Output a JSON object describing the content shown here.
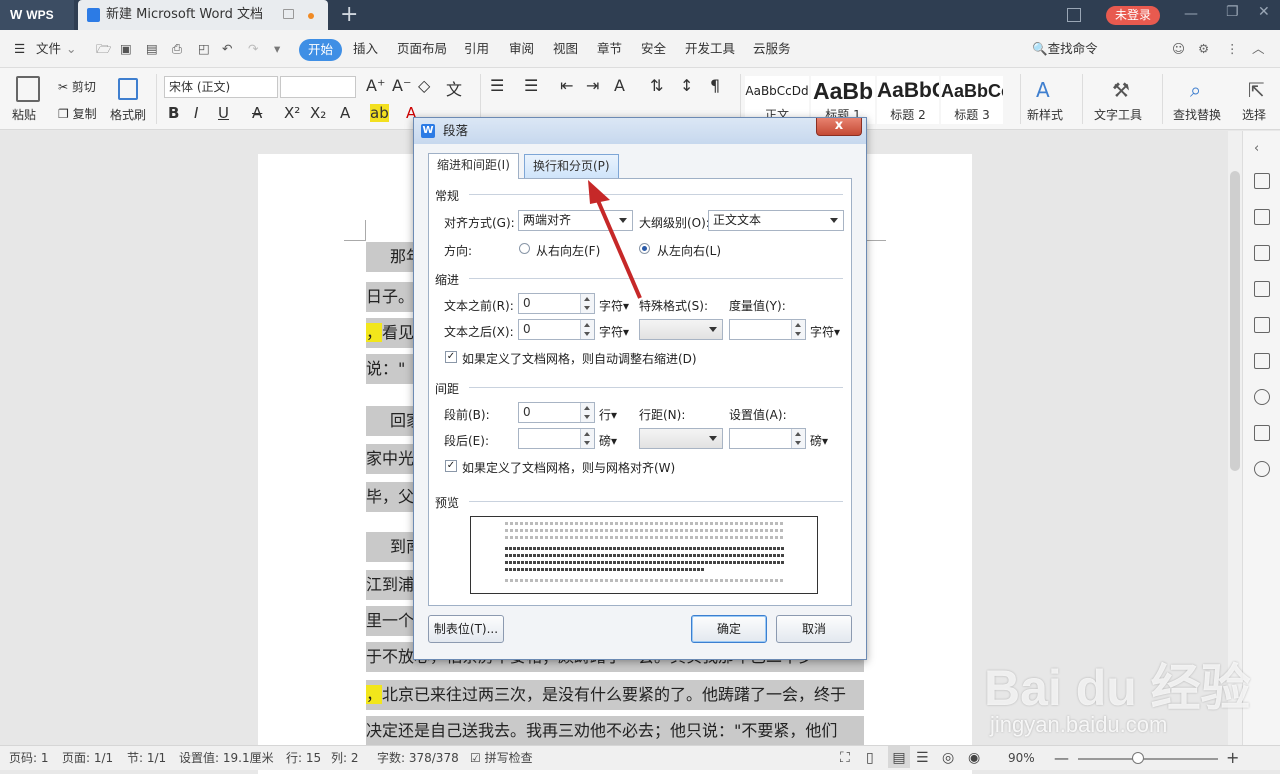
{
  "titlebar": {
    "app_name": "WPS",
    "doc_tab": "新建 Microsoft Word 文档",
    "login": "未登录"
  },
  "menubar": {
    "file": "文件",
    "items": [
      "开始",
      "插入",
      "页面布局",
      "引用",
      "审阅",
      "视图",
      "章节",
      "安全",
      "开发工具",
      "云服务"
    ],
    "search": "查找命令"
  },
  "ribbon": {
    "paste": "粘贴",
    "cut": "剪切",
    "copy": "复制",
    "format_painter": "格式刷",
    "font_name": "宋体 (正文)",
    "styles": [
      "AaBbCcDd",
      "AaBb",
      "AaBbC",
      "AaBbCc"
    ],
    "style_names": [
      "正文",
      "标题 1",
      "标题 2",
      "标题 3"
    ],
    "new_style": "新样式",
    "text_tools": "文字工具",
    "find_replace": "查找替换",
    "select": "选择"
  },
  "document": {
    "lines": [
      "那年",
      "日子。",
      "，看见",
      "说：\"",
      "回家",
      "家中光",
      "毕，父",
      "到南",
      "江到浦",
      "里一个",
      "于不放心，怕茶房不妥帖；颇踌躇了一会。其实我那年已二十岁",
      "，北京已来往过两三次，是没有什么要紧的了。他踌躇了一会，终于",
      "决定还是自己送我去。我再三劝他不必去；他只说：\"不要紧，他们"
    ]
  },
  "dialog": {
    "title": "段落",
    "close": "x",
    "tabs": [
      "缩进和间距(I)",
      "换行和分页(P)"
    ],
    "general": {
      "section": "常规",
      "align_label": "对齐方式(G):",
      "align_value": "两端对齐",
      "outline_label": "大纲级别(O):",
      "outline_value": "正文文本",
      "direction_label": "方向:",
      "rtl": "从右向左(F)",
      "ltr": "从左向右(L)"
    },
    "indent": {
      "section": "缩进",
      "before_label": "文本之前(R):",
      "before_value": "0",
      "after_label": "文本之后(X):",
      "after_value": "0",
      "unit": "字符",
      "special_label": "特殊格式(S):",
      "measure_label": "度量值(Y):",
      "unit2": "字符",
      "auto_adjust": "如果定义了文档网格，则自动调整右缩进(D)"
    },
    "spacing": {
      "section": "间距",
      "before_label": "段前(B):",
      "before_value": "0",
      "before_unit": "行",
      "after_label": "段后(E):",
      "after_unit": "磅",
      "line_label": "行距(N):",
      "setting_label": "设置值(A):",
      "setting_unit": "磅",
      "snap_grid": "如果定义了文档网格，则与网格对齐(W)"
    },
    "preview": {
      "section": "预览"
    },
    "buttons": {
      "tabs": "制表位(T)...",
      "ok": "确定",
      "cancel": "取消"
    }
  },
  "statusbar": {
    "page_no": "页码: 1",
    "pages": "页面: 1/1",
    "section": "节: 1/1",
    "setting": "设置值: 19.1厘米",
    "row": "行: 15",
    "col": "列: 2",
    "words": "字数: 378/378",
    "spell": "拼写检查",
    "zoom": "90%"
  },
  "watermark": {
    "brand": "Bai du 经验",
    "url": "jingyan.baidu.com"
  }
}
